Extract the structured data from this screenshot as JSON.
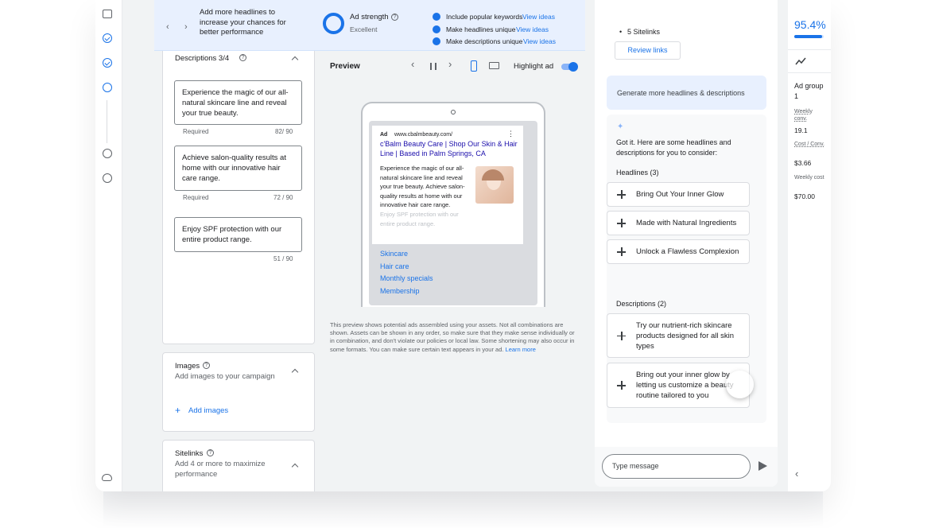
{
  "ad_strength": {
    "tip": "Add more headlines to increase your chances for better performance",
    "title": "Ad strength",
    "rating": "Excellent",
    "checks": [
      {
        "text": "Include popular keywords",
        "link": "View ideas"
      },
      {
        "text": "Make headlines unique",
        "link": "View ideas"
      },
      {
        "text": "Make descriptions unique",
        "link": "View ideas"
      }
    ]
  },
  "descriptions": {
    "title": "Descriptions 3/4",
    "items": [
      {
        "text": "Experience the magic of our all-natural skincare line and reveal your true beauty.",
        "required": "Required",
        "count": "82/ 90"
      },
      {
        "text": "Achieve salon-quality results at home with our innovative hair care range.",
        "required": "Required",
        "count": "72 / 90"
      },
      {
        "text": "Enjoy SPF protection with our entire product range.",
        "required": "",
        "count": "51 / 90"
      }
    ]
  },
  "images": {
    "title": "Images",
    "subtitle": "Add images to your campaign",
    "add_label": "Add images"
  },
  "sitelinks": {
    "title": "Sitelinks",
    "subtitle": "Add 4 or more to maximize performance"
  },
  "preview": {
    "title": "Preview",
    "highlight_label": "Highlight ad",
    "ad": {
      "badge": "Ad",
      "url": "www.cbalmbeauty.com/",
      "headline": "c'Balm Beauty Care | Shop Our Skin & Hair Line | Based in Palm Springs, CA",
      "body": "Experience the magic of our all-natural skincare line and reveal your true beauty. Achieve salon-quality results at home with our innovative hair care range.",
      "faded": "Enjoy SPF protection with our entire product range.",
      "sitelinks": [
        "Skincare",
        "Hair care",
        "Monthly specials",
        "Membership"
      ]
    },
    "disclaimer": "This preview shows potential ads assembled using your assets. Not all combinations are shown. Assets can be shown in any order, so make sure that they make sense individually or in combination, and don't violate our policies or local law. Some shortening may also occur in some formats. You can make sure certain text appears in your ad.",
    "learn_more": "Learn more"
  },
  "chat": {
    "sitelinks_bullet": "5 Sitelinks",
    "review_links": "Review links",
    "user_prompt": "Generate more headlines & descriptions",
    "reply": "Got it. Here are some headlines and descriptions for you to consider:",
    "headlines_label": "Headlines (3)",
    "headlines": [
      "Bring Out Your Inner Glow",
      "Made with Natural Ingredients",
      "Unlock a Flawless Complexion"
    ],
    "descriptions_label": "Descriptions (2)",
    "descriptions": [
      "Try our nutrient-rich skincare products designed for all skin types",
      "Bring out your inner glow by letting us customize a beauty routine tailored to you"
    ],
    "input_placeholder": "Type message"
  },
  "summary": {
    "percent": "95.4%",
    "progress": 0.954,
    "group": "Ad group 1",
    "metrics": [
      {
        "label": "Weekly conv.",
        "value": "19.1"
      },
      {
        "label": "Cost / Conv.",
        "value": "$3.66"
      },
      {
        "label": "Weekly cost",
        "value": "$70.00"
      }
    ]
  },
  "colors": {
    "accent": "#1a73e8",
    "strength_bg": "#e8f0fe",
    "prompt_bg": "#e8f0fe"
  }
}
